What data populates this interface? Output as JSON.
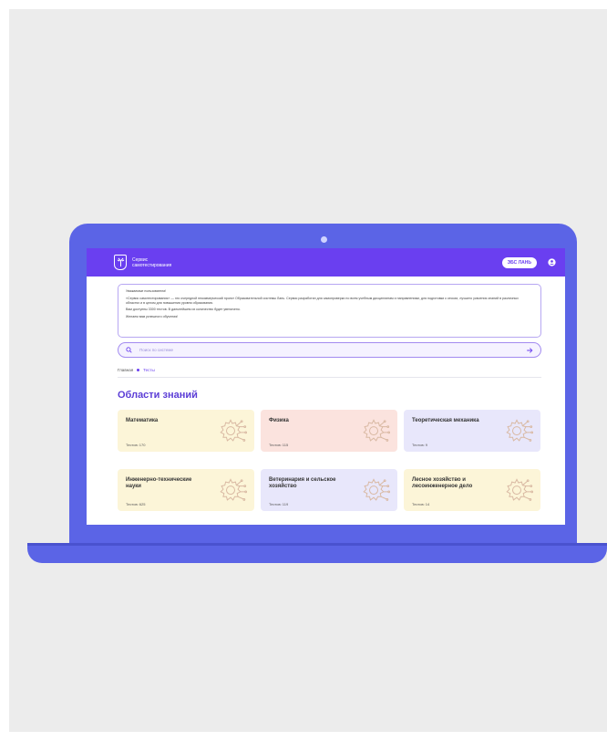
{
  "header": {
    "brand_line1": "Сервис",
    "brand_line2": "самотестирования",
    "ebs_button": "ЭБС ЛАНЬ",
    "accent": "#6a3ff0"
  },
  "notice": {
    "greeting": "Уважаемые пользователи!",
    "paragraph1": "«Сервис самотестирования» — это очередной некоммерческий проект Образовательной системы Лань. Сервис разработан для самопроверки по всем учебным дисциплинам и направлениям, для подготовки к сессии, лучшего усвоения знаний в различных областях и в целом для повышения уровня образования.",
    "paragraph2": "Вам доступны 3300 тестов. В дальнейшем их количество будет увеличено.",
    "paragraph3": "Желаем вам успешного обучения!"
  },
  "search": {
    "placeholder": "Поиск по системе"
  },
  "breadcrumb": {
    "home": "Главная",
    "current": "Тесты"
  },
  "page_title": "Области знаний",
  "cards": [
    {
      "title": "Математика",
      "count": "Тестов: 170",
      "color": "#fcf5d8"
    },
    {
      "title": "Физика",
      "count": "Тестов: 115",
      "color": "#fbe3de"
    },
    {
      "title": "Теоретическая механика",
      "count": "Тестов: 9",
      "color": "#e8e7fb"
    },
    {
      "title": "Инженерно-технические науки",
      "count": "Тестов: 625",
      "color": "#fcf5d8"
    },
    {
      "title": "Ветеринария и сельское хозяйство",
      "count": "Тестов: 119",
      "color": "#e8e7fb"
    },
    {
      "title": "Лесное хозяйство и лесоинженерное дело",
      "count": "Тестов: 14",
      "color": "#fcf5d8"
    }
  ]
}
